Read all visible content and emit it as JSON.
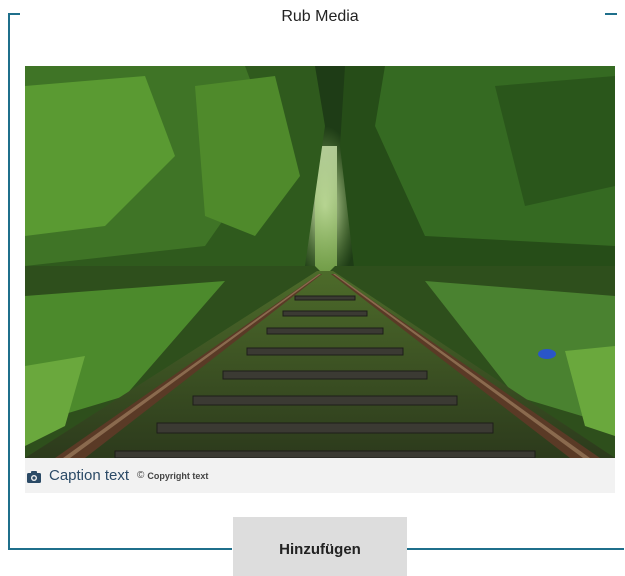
{
  "panel": {
    "legend": "Rub Media",
    "accent_color": "#1f6f8b"
  },
  "media": {
    "image_subject": "railway-track-through-forest"
  },
  "caption": {
    "icon": "camera-icon",
    "text": "Caption text",
    "copyright_sign": "©",
    "copyright_text": "Copyright text"
  },
  "actions": {
    "add_label": "Hinzufügen"
  }
}
